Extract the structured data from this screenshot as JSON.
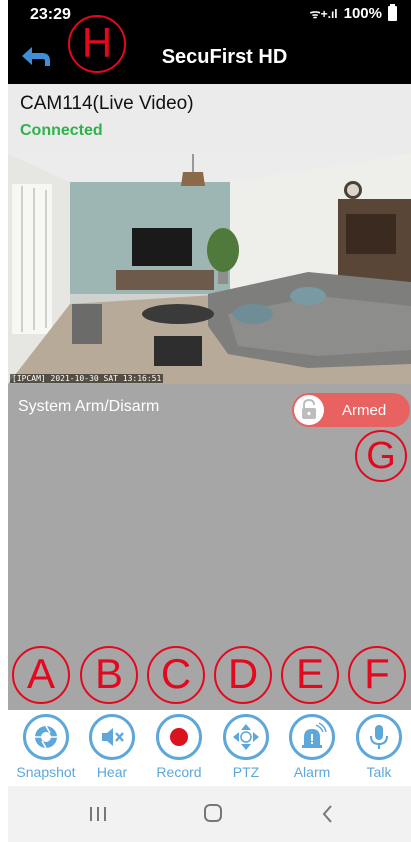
{
  "status_bar": {
    "time": "23:29",
    "signal": "ᯤ+.ıl",
    "battery": "100%"
  },
  "app_bar": {
    "title": "SecuFirst HD",
    "back_icon": "back-arrow-icon"
  },
  "camera": {
    "name": "CAM114(Live Video)",
    "status": "Connected",
    "osd": "[IPCAM] 2021-10-30 SAT 13:16:51"
  },
  "arm_panel": {
    "label": "System Arm/Disarm",
    "toggle_text": "Armed",
    "toggle_icon": "lock-open-icon"
  },
  "toolbar": {
    "items": [
      {
        "label": "Snapshot",
        "icon": "camera-shutter-icon"
      },
      {
        "label": "Hear",
        "icon": "speaker-mute-icon"
      },
      {
        "label": "Record",
        "icon": "record-icon"
      },
      {
        "label": "PTZ",
        "icon": "ptz-arrows-icon"
      },
      {
        "label": "Alarm",
        "icon": "siren-icon"
      },
      {
        "label": "Talk",
        "icon": "microphone-icon"
      }
    ]
  },
  "annotations": {
    "a": "A",
    "b": "B",
    "c": "C",
    "d": "D",
    "e": "E",
    "f": "F",
    "g": "G",
    "h": "H"
  },
  "colors": {
    "accent_blue": "#5da7db",
    "connected_green": "#2db34a",
    "armed_red": "#e86262",
    "annotation_red": "#e4081f",
    "panel_gray": "#a6a6a6"
  }
}
